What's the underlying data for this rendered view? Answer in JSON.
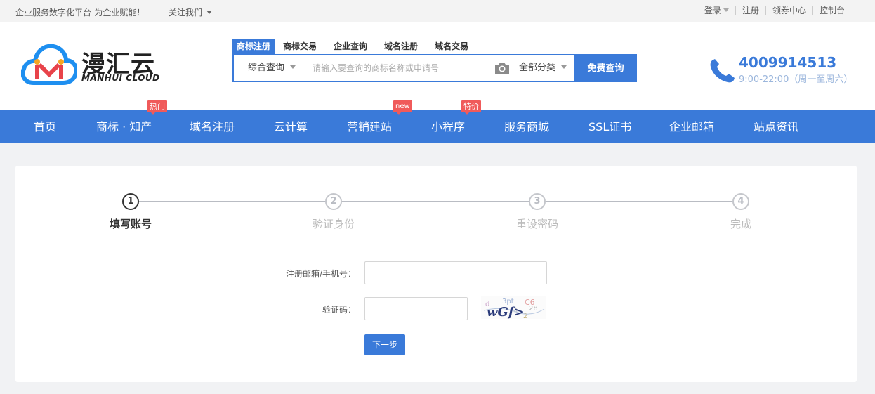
{
  "topbar": {
    "slogan": "企业服务数字化平台-为企业赋能！",
    "follow": "关注我们",
    "links": [
      "登录",
      "注册",
      "领券中心",
      "控制台"
    ]
  },
  "brand": {
    "name": "漫汇云",
    "subtitle": "MANHUI CLOUD",
    "logo_colors": [
      "#1e8ff0",
      "#e8434a",
      "#f5a623"
    ]
  },
  "search": {
    "tabs": [
      "商标注册",
      "商标交易",
      "企业查询",
      "域名注册",
      "域名交易"
    ],
    "scope": "综合查询",
    "placeholder": "请输入要查询的商标名称或申请号",
    "category": "全部分类",
    "button": "免费查询"
  },
  "contact": {
    "phone": "4009914513",
    "hours": "9:00-22:00（周一至周六）"
  },
  "nav": {
    "items": [
      "首页",
      "商标 · 知产",
      "域名注册",
      "云计算",
      "营销建站",
      "小程序",
      "服务商城",
      "SSL证书",
      "企业邮箱",
      "站点资讯"
    ],
    "badges": {
      "hot": "热门",
      "new": "new",
      "sale": "特价"
    }
  },
  "steps": [
    {
      "num": "1",
      "label": "填写账号"
    },
    {
      "num": "2",
      "label": "验证身份"
    },
    {
      "num": "3",
      "label": "重设密码"
    },
    {
      "num": "4",
      "label": "完成"
    }
  ],
  "form": {
    "account_label": "注册邮箱/手机号：",
    "account_value": "",
    "captcha_label": "验证码：",
    "captcha_value": "",
    "captcha_text": "wGf>",
    "submit": "下一步"
  },
  "colors": {
    "primary": "#3a7ad9",
    "badge": "#f05a5a",
    "page_bg": "#f1f2f4"
  }
}
